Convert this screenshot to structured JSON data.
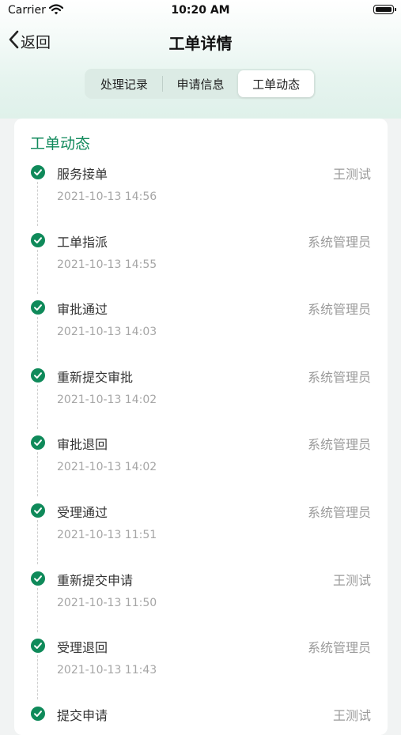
{
  "status_bar": {
    "carrier": "Carrier",
    "time": "10:20 AM"
  },
  "nav": {
    "back_label": "返回",
    "title": "工单详情"
  },
  "tabs": [
    {
      "label": "处理记录",
      "active": false
    },
    {
      "label": "申请信息",
      "active": false
    },
    {
      "label": "工单动态",
      "active": true
    }
  ],
  "section_title": "工单动态",
  "accent_color": "#0f8a5a",
  "timeline": [
    {
      "title": "服务接单",
      "operator": "王测试",
      "time": "2021-10-13 14:56"
    },
    {
      "title": "工单指派",
      "operator": "系统管理员",
      "time": "2021-10-13 14:55"
    },
    {
      "title": "审批通过",
      "operator": "系统管理员",
      "time": "2021-10-13 14:03"
    },
    {
      "title": "重新提交审批",
      "operator": "系统管理员",
      "time": "2021-10-13 14:02"
    },
    {
      "title": "审批退回",
      "operator": "系统管理员",
      "time": "2021-10-13 14:02"
    },
    {
      "title": "受理通过",
      "operator": "系统管理员",
      "time": "2021-10-13 11:51"
    },
    {
      "title": "重新提交申请",
      "operator": "王测试",
      "time": "2021-10-13 11:50"
    },
    {
      "title": "受理退回",
      "operator": "系统管理员",
      "time": "2021-10-13 11:43"
    },
    {
      "title": "提交申请",
      "operator": "王测试",
      "time": ""
    }
  ]
}
